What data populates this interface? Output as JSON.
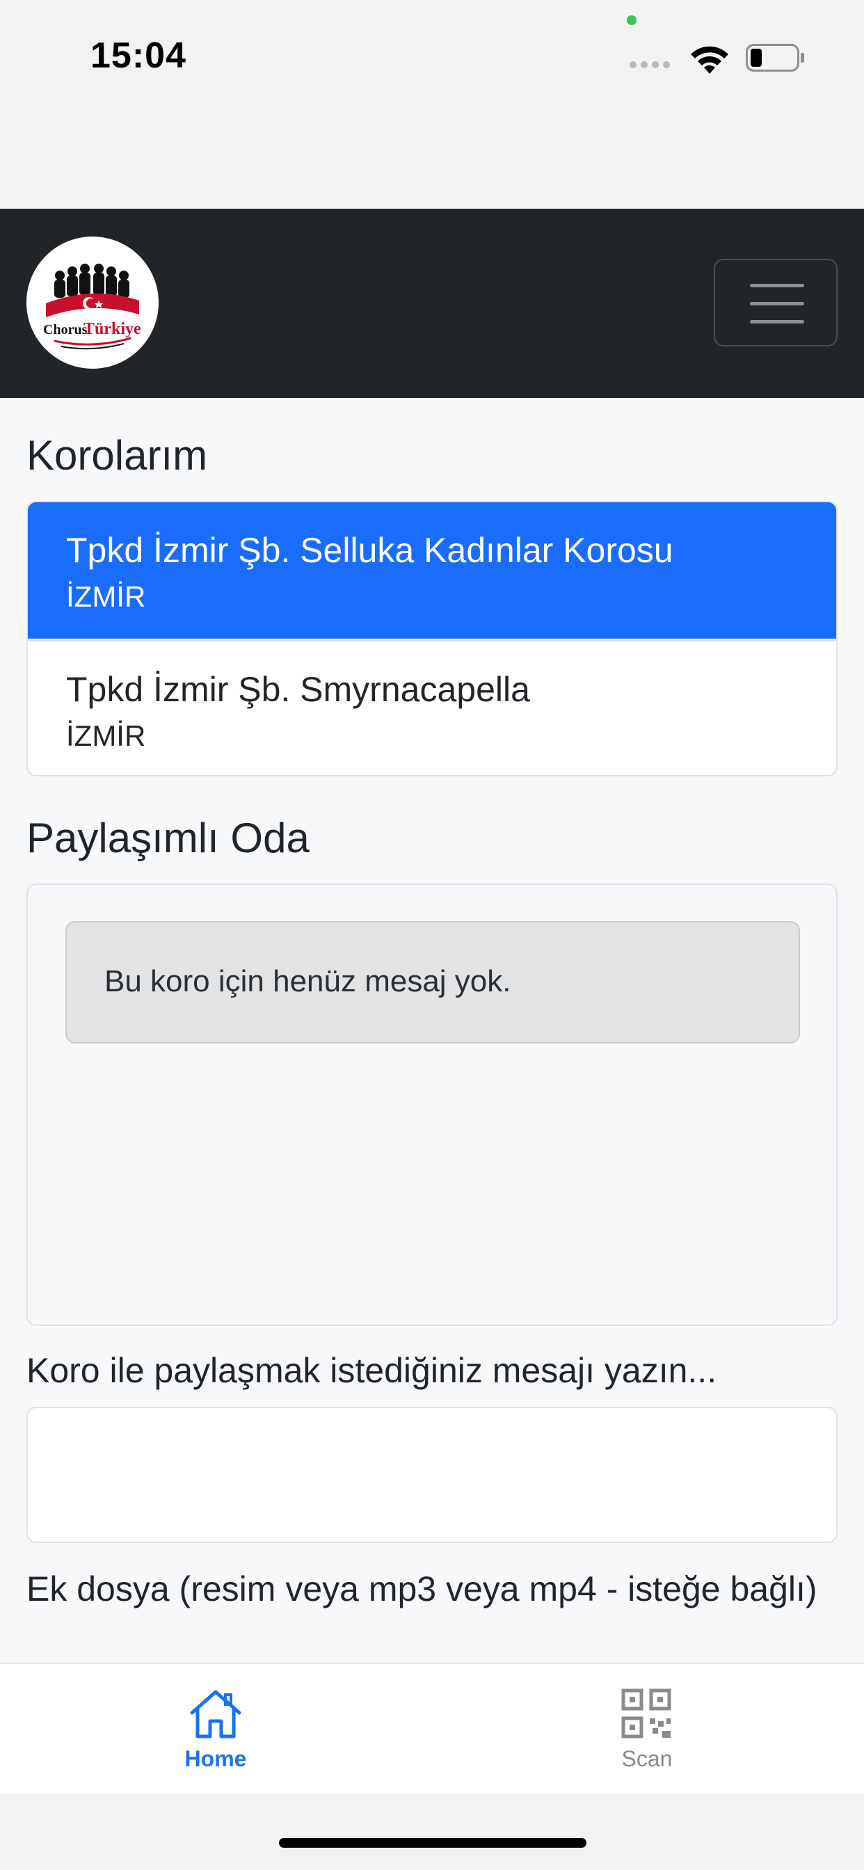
{
  "status_bar": {
    "time": "15:04"
  },
  "navbar": {
    "logo_text_left": "Chorus",
    "logo_text_right": "Türkiye",
    "menu_icon": "hamburger-menu-icon"
  },
  "choirs_section": {
    "title": "Korolarım",
    "items": [
      {
        "name": "Tpkd İzmir Şb. Selluka Kadınlar Korosu",
        "city": "İZMİR",
        "active": true
      },
      {
        "name": "Tpkd İzmir Şb. Smyrnacapella",
        "city": "İZMİR",
        "active": false
      }
    ]
  },
  "shared_room": {
    "title": "Paylaşımlı Oda",
    "empty_message": "Bu koro için henüz mesaj yok."
  },
  "message_form": {
    "message_label": "Koro ile paylaşmak istediğiniz mesajı yazın...",
    "message_value": "",
    "attachment_label": "Ek dosya (resim veya mp3 veya mp4 - isteğe bağlı)"
  },
  "tab_bar": {
    "tabs": [
      {
        "label": "Home",
        "icon": "home-icon",
        "active": true
      },
      {
        "label": "Scan",
        "icon": "qr-code-icon",
        "active": false
      }
    ]
  },
  "colors": {
    "navbar": "#212529",
    "active_item": "#1a6dfa",
    "active_tab": "#1a73e8"
  }
}
